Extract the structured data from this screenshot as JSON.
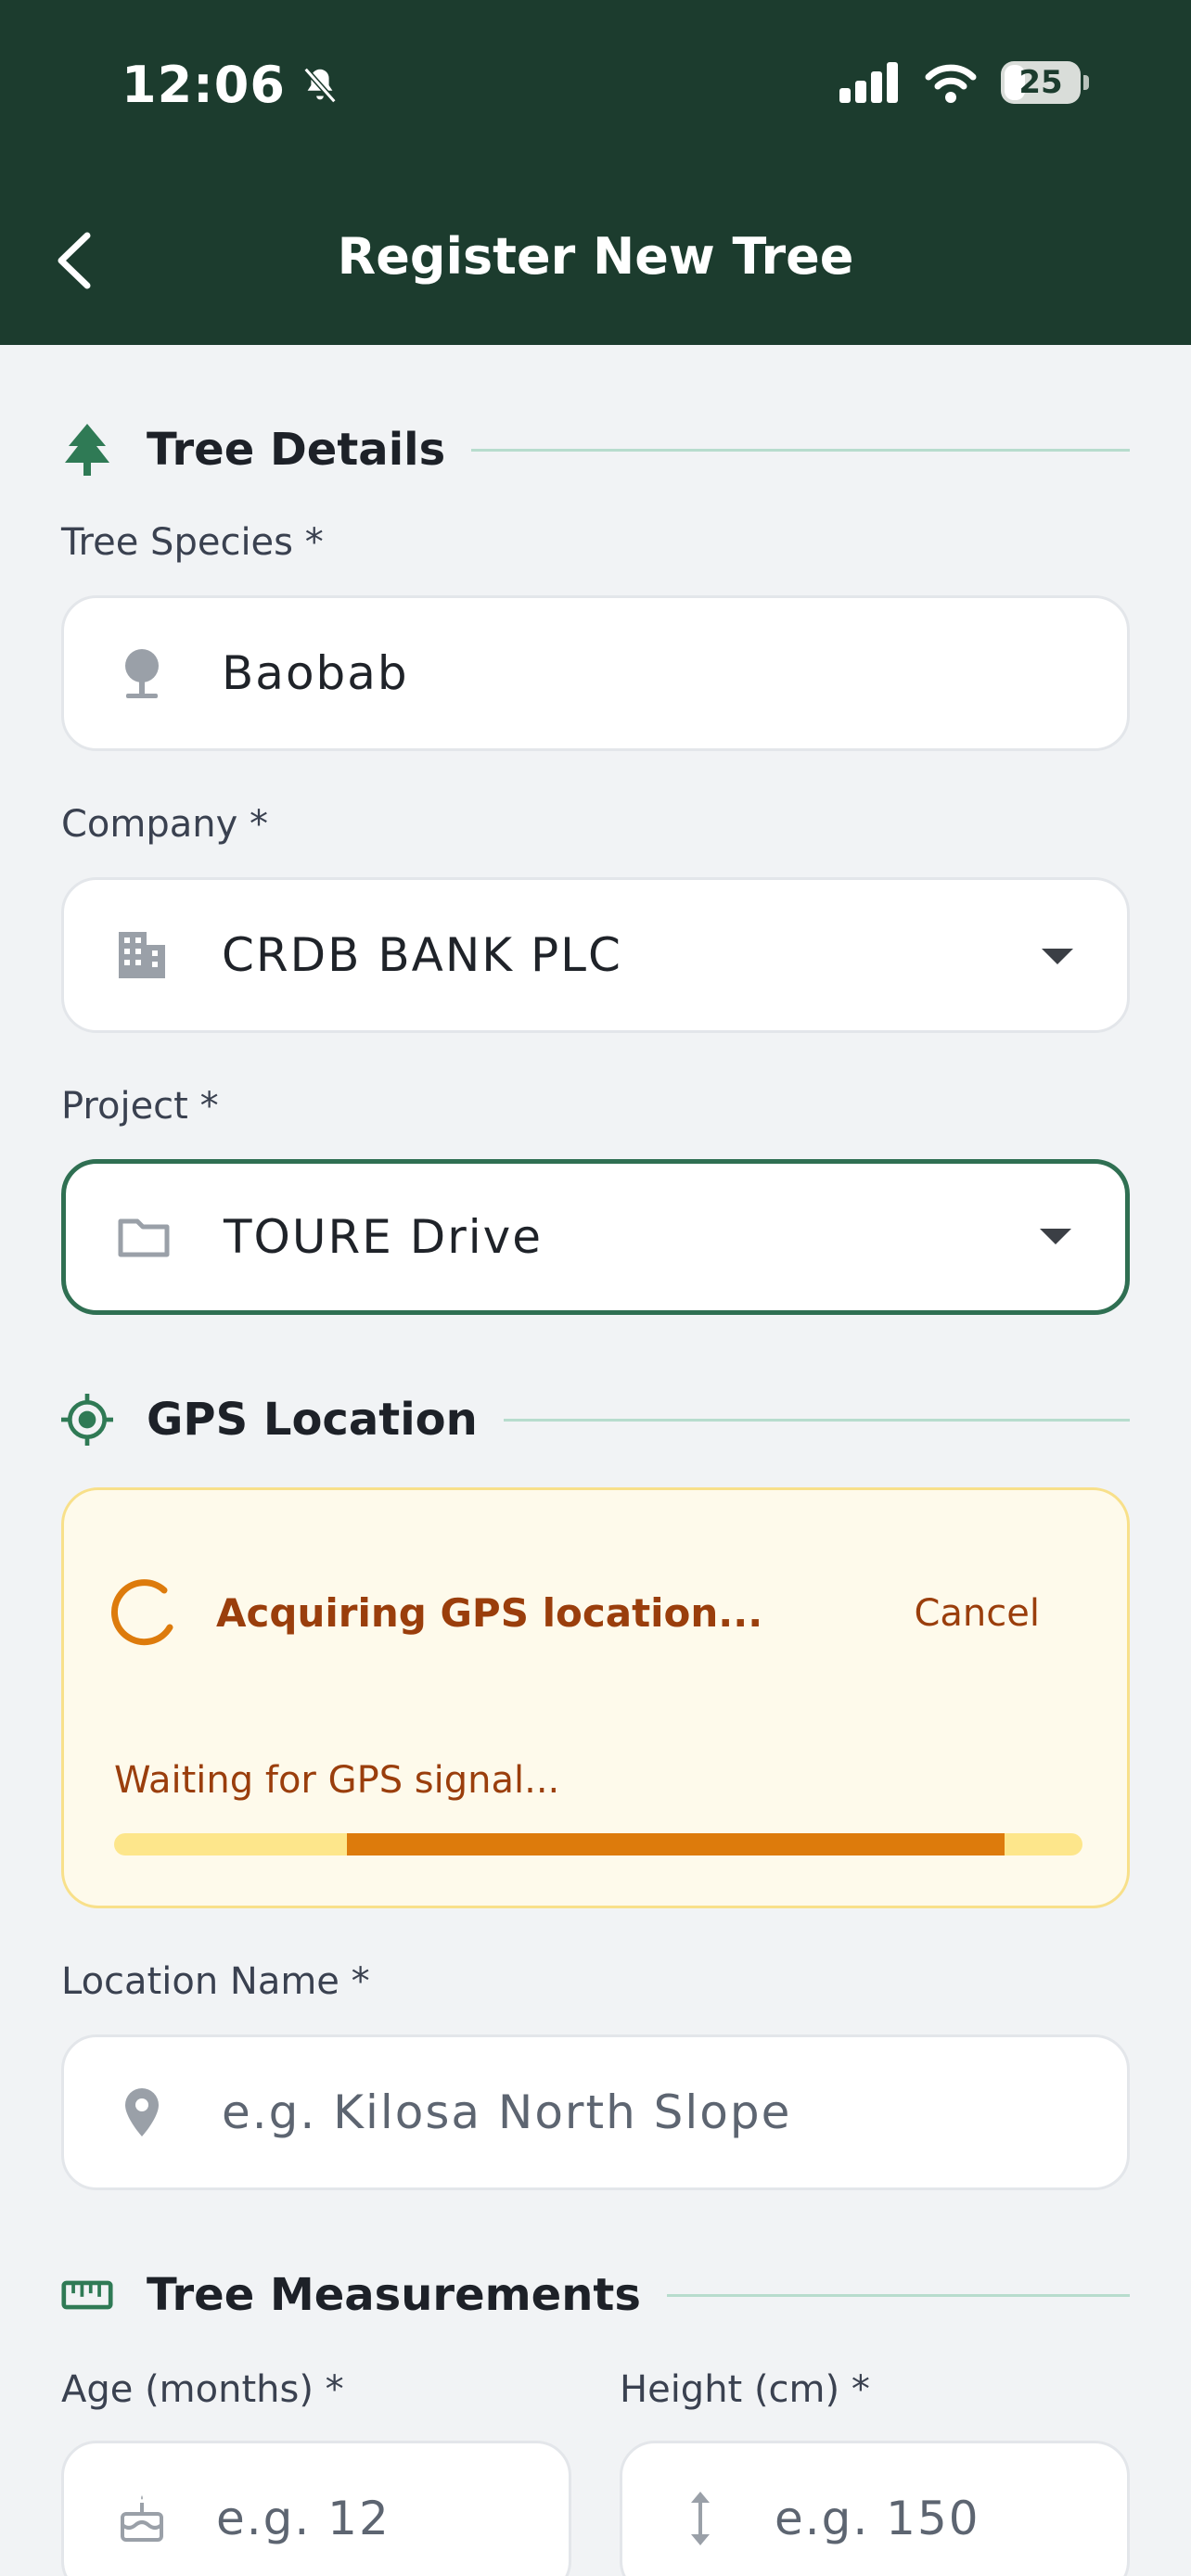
{
  "status_bar": {
    "time": "12:06",
    "battery": "25"
  },
  "header": {
    "title": "Register New Tree"
  },
  "tree_details": {
    "title": "Tree Details",
    "species": {
      "label": "Tree Species *",
      "value": "Baobab"
    },
    "company": {
      "label": "Company *",
      "value": "CRDB BANK PLC"
    },
    "project": {
      "label": "Project *",
      "value": "TOURE Drive"
    }
  },
  "gps_location": {
    "title": "GPS Location",
    "status": "Acquiring GPS location...",
    "cancel_label": "Cancel",
    "waiting_text": "Waiting for GPS signal...",
    "progress": {
      "start": 0.24,
      "end": 0.92
    }
  },
  "location_name": {
    "label": "Location Name *",
    "placeholder": "e.g. Kilosa North Slope"
  },
  "measurements": {
    "title": "Tree Measurements",
    "age": {
      "label": "Age (months) *",
      "placeholder": "e.g. 12"
    },
    "height": {
      "label": "Height (cm) *",
      "placeholder": "e.g. 150"
    }
  },
  "colors": {
    "header_bg": "#1c3c2e",
    "accent": "#2f6f52",
    "warning_text": "#9a3e0c",
    "progress": "#dd7b0c"
  }
}
